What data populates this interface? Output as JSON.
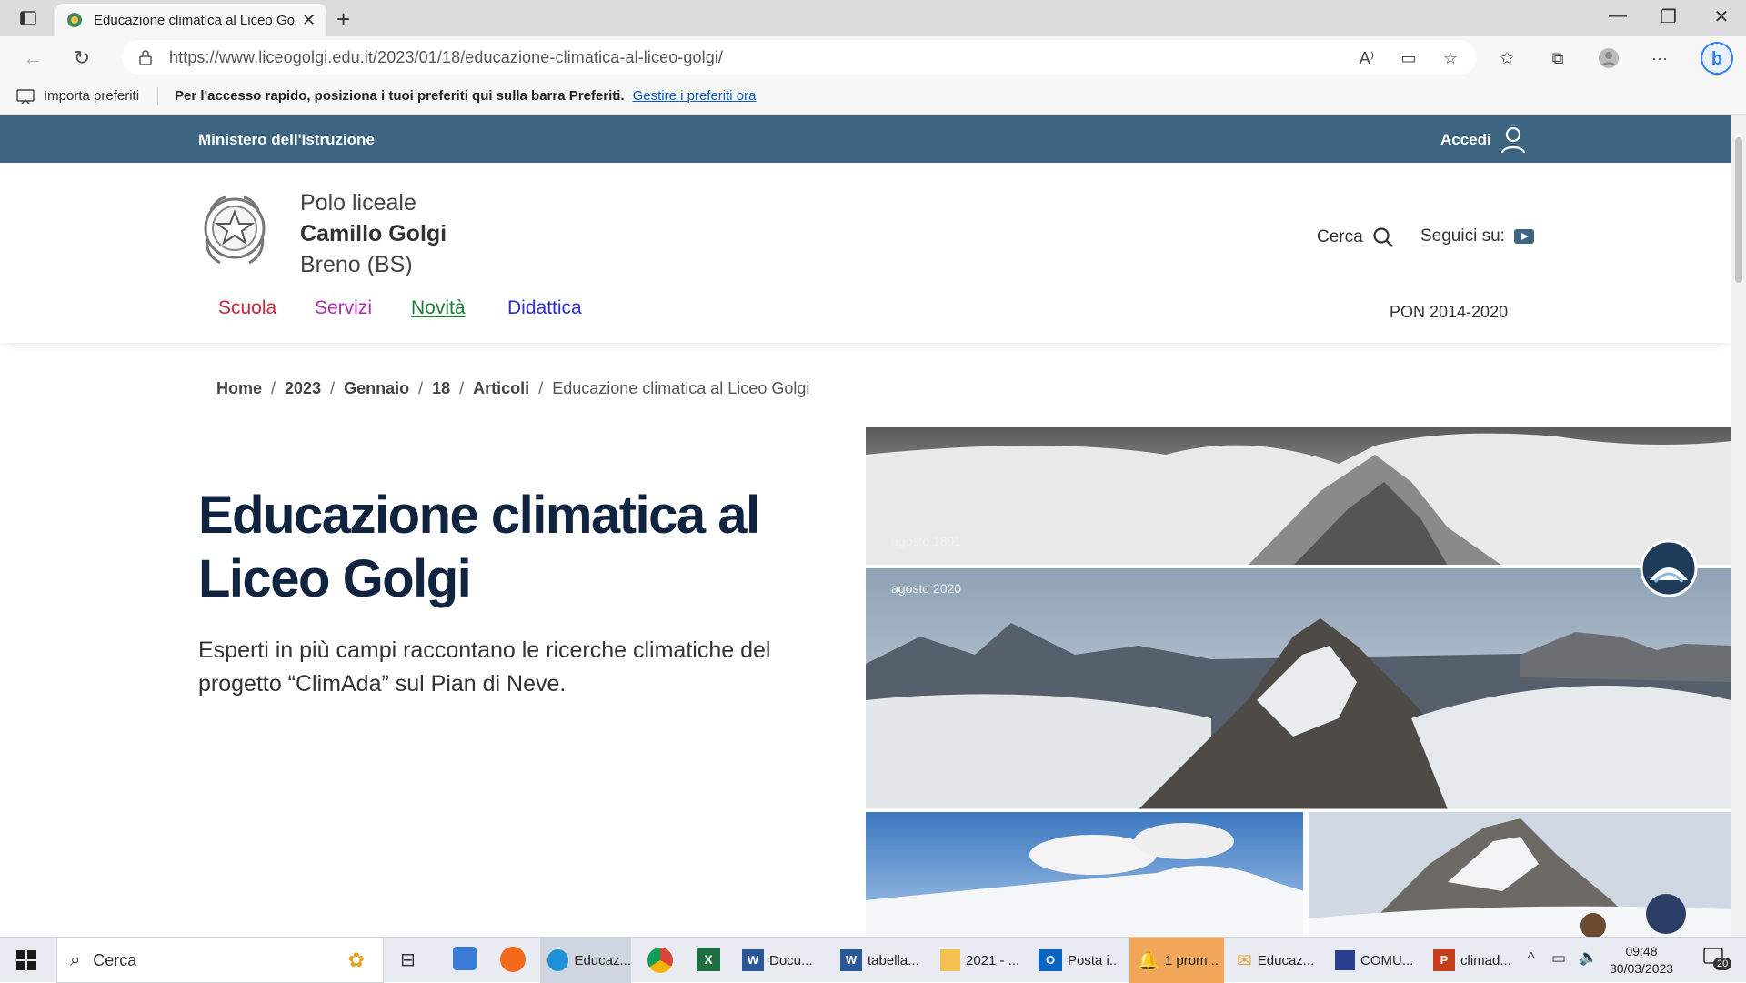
{
  "browser": {
    "tab_title": "Educazione climatica al Liceo Gol",
    "url": "https://www.liceogolgi.edu.it/2023/01/18/educazione-climatica-al-liceo-golgi/",
    "favorites_import": "Importa preferiti",
    "favorites_message": "Per l'accesso rapido, posiziona i tuoi preferiti qui sulla barra Preferiti.",
    "favorites_link": "Gestire i preferiti ora"
  },
  "site": {
    "ministry": "Ministero dell'Istruzione",
    "login": "Accedi",
    "school_line1": "Polo liceale",
    "school_name": "Camillo Golgi",
    "school_place": "Breno (BS)",
    "search": "Cerca",
    "follow": "Seguici su:",
    "menu": [
      "Scuola",
      "Servizi",
      "Novità",
      "Didattica"
    ],
    "menu_colors": [
      "#c8273a",
      "#b02bb0",
      "#1f7a3a",
      "#2c2fc8"
    ],
    "pon": "PON 2014-2020"
  },
  "breadcrumb": [
    "Home",
    "2023",
    "Gennaio",
    "18",
    "Articoli",
    "Educazione climatica al Liceo Golgi"
  ],
  "article": {
    "title": "Educazione climatica al Liceo Golgi",
    "lede": "Esperti in più campi raccontano le ricerche climatiche del progetto “ClimAda” sul Pian di Neve."
  },
  "hero_labels": {
    "top": "agosto 1891",
    "mid": "agosto 2020"
  },
  "taskbar": {
    "search": "Cerca",
    "apps": [
      "Educaz...",
      "Docu...",
      "tabella...",
      "2021 - ...",
      "Posta i...",
      "1 prom...",
      "Educaz...",
      "COMU...",
      "climad..."
    ],
    "time": "09:48",
    "date": "30/03/2023",
    "notifications": "20"
  }
}
